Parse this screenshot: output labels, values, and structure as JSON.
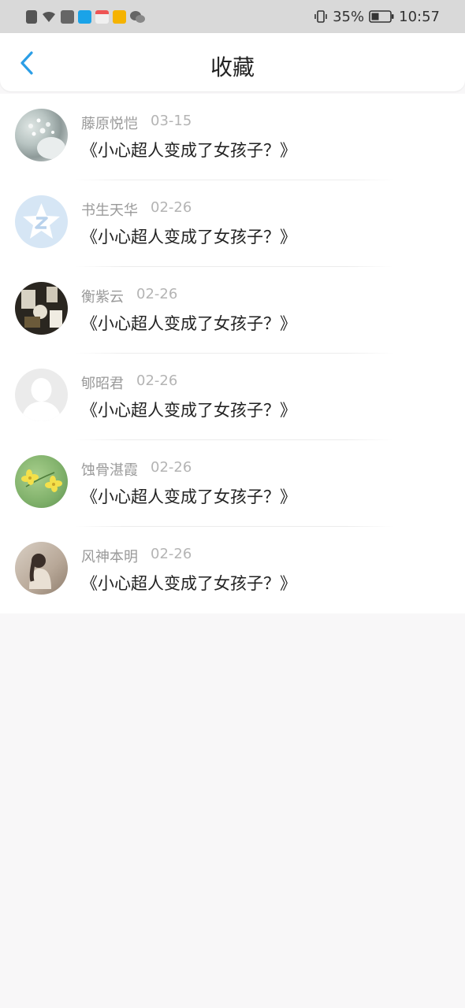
{
  "status": {
    "battery_percent": "35%",
    "time": "10:57"
  },
  "header": {
    "title": "收藏"
  },
  "items": [
    {
      "name": "藤原悦恺",
      "date": "03-15",
      "title": "《小心超人变成了女孩子？》",
      "avatar": "frost-plant-avatar"
    },
    {
      "name": "书生天华",
      "date": "02-26",
      "title": "《小心超人变成了女孩子？》",
      "avatar": "default-z-avatar"
    },
    {
      "name": "衡紫云",
      "date": "02-26",
      "title": "《小心超人变成了女孩子？》",
      "avatar": "dark-photo-avatar"
    },
    {
      "name": "郇昭君",
      "date": "02-26",
      "title": "《小心超人变成了女孩子？》",
      "avatar": "blank-person-avatar"
    },
    {
      "name": "蚀骨湛霞",
      "date": "02-26",
      "title": "《小心超人变成了女孩子？》",
      "avatar": "yellow-flower-avatar"
    },
    {
      "name": "风神本明",
      "date": "02-26",
      "title": "《小心超人变成了女孩子？》",
      "avatar": "sitting-girl-avatar"
    }
  ],
  "colors": {
    "accent": "#2b9ee6",
    "background": "#f8f7f8"
  }
}
